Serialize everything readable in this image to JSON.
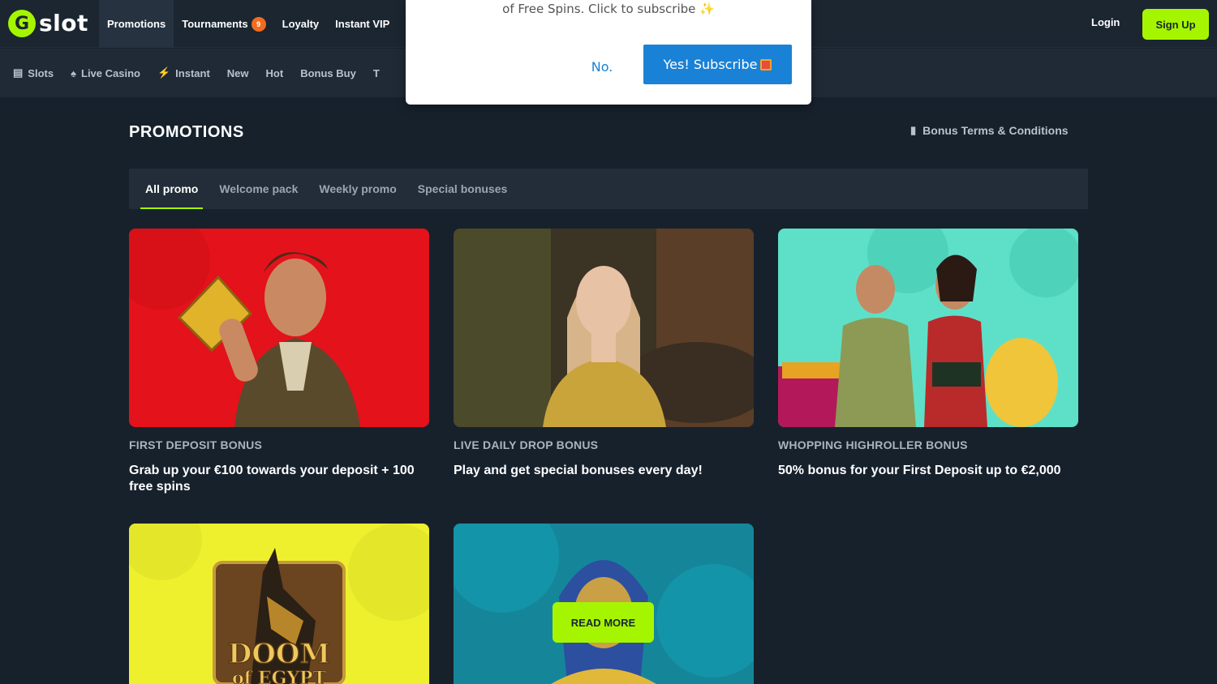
{
  "header": {
    "logo_letter": "G",
    "logo_text": "slot",
    "nav": [
      {
        "label": "Promotions",
        "active": true
      },
      {
        "label": "Tournaments",
        "badge": "9"
      },
      {
        "label": "Loyalty"
      },
      {
        "label": "Instant VIP"
      }
    ],
    "login_label": "Login",
    "signup_label": "Sign Up"
  },
  "categories": [
    {
      "label": "Slots",
      "icon": "slot-machine-icon"
    },
    {
      "label": "Live Casino",
      "icon": "spade-icon"
    },
    {
      "label": "Instant",
      "icon": "lightning-icon"
    },
    {
      "label": "New"
    },
    {
      "label": "Hot"
    },
    {
      "label": "Bonus Buy"
    },
    {
      "label": "T"
    }
  ],
  "page": {
    "title": "PROMOTIONS",
    "terms_label": "Bonus Terms & Conditions"
  },
  "tabs": [
    {
      "label": "All promo",
      "active": true
    },
    {
      "label": "Welcome pack"
    },
    {
      "label": "Weekly promo"
    },
    {
      "label": "Special bonuses"
    }
  ],
  "cards": [
    {
      "category": "FIRST DEPOSIT BONUS",
      "title": "Grab up your €100 towards your deposit + 100 free spins",
      "bg": "#e3121b"
    },
    {
      "category": "LIVE DAILY DROP BONUS",
      "title": "Play and get special bonuses every day!",
      "bg": "#3b3324"
    },
    {
      "category": "WHOPPING HIGHROLLER BONUS",
      "title": "50% bonus for your First Deposit up to €2,000",
      "bg": "#5ee0c8"
    },
    {
      "bg": "#eef02e",
      "image_text": "DOOM of EGYPT"
    },
    {
      "bg": "#15869a",
      "button": "READ MORE"
    }
  ],
  "modal": {
    "text": "of Free Spins. Click to subscribe ✨",
    "no_label": "No.",
    "yes_label": "Yes! Subscribe"
  },
  "colors": {
    "accent": "#a6f500",
    "background": "#17212c",
    "badge": "#f26b1f",
    "modal_button": "#1a82d6"
  }
}
